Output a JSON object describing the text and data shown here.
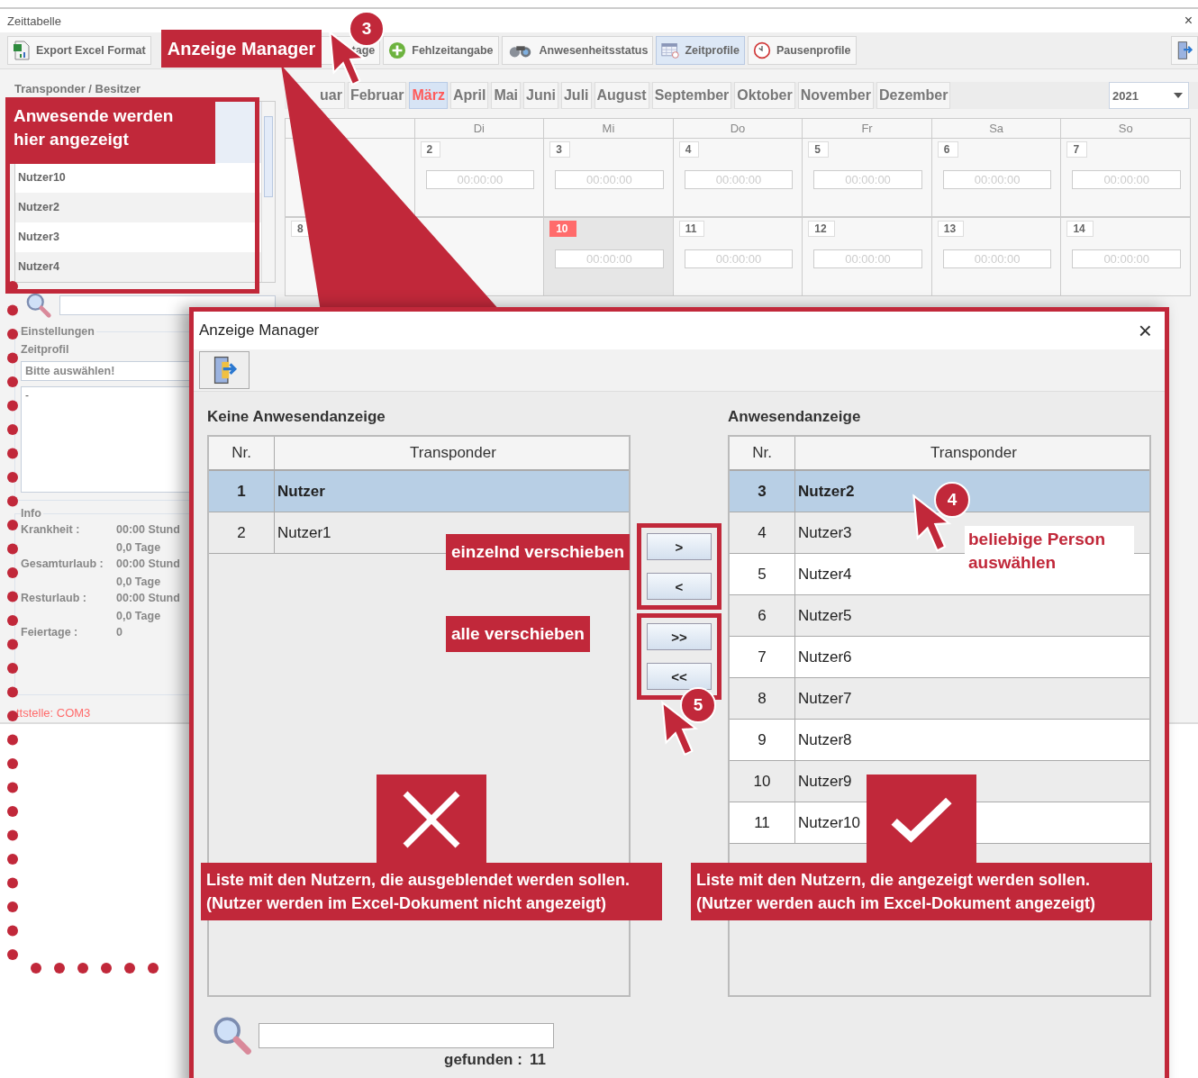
{
  "window": {
    "title": "Zeittabelle",
    "close": "×"
  },
  "toolbar": [
    {
      "label": "Export Excel Format",
      "kind": "excel",
      "selected": false
    },
    {
      "label": "tage",
      "kind": "plain",
      "selected": false
    },
    {
      "label": "Fehlzeitangabe",
      "kind": "plus",
      "selected": false
    },
    {
      "label": "Anwesenheitsstatus",
      "kind": "binoculars",
      "selected": false
    },
    {
      "label": "Zeitprofile",
      "kind": "calendar",
      "selected": true
    },
    {
      "label": "Pausenprofile",
      "kind": "clock",
      "selected": false
    }
  ],
  "left_panel": {
    "title": "Transponder / Besitzer",
    "items": [
      "Nutzer10",
      "Nutzer2",
      "Nutzer3",
      "Nutzer4"
    ],
    "settings": {
      "legend": "Einstellungen",
      "label": "Zeitprofil",
      "select": "Bitte auswählen!",
      "note": "-"
    },
    "info": {
      "legend": "Info",
      "rows": [
        {
          "label": "Krankheit :",
          "values": [
            "00:00 Stund",
            "0,0 Tage"
          ]
        },
        {
          "label": "Gesamturlaub :",
          "values": [
            "00:00 Stund",
            "0,0 Tage"
          ]
        },
        {
          "label": "Resturlaub :",
          "values": [
            "00:00 Stund",
            "0,0 Tage"
          ]
        },
        {
          "label": "Feiertage :",
          "values": [
            "0"
          ]
        }
      ]
    },
    "status": "ttstelle: COM3"
  },
  "calendar": {
    "months": [
      {
        "label": "uar",
        "selected": false
      },
      {
        "label": "Februar",
        "selected": false
      },
      {
        "label": "März",
        "selected": true
      },
      {
        "label": "April",
        "selected": false
      },
      {
        "label": "Mai",
        "selected": false
      },
      {
        "label": "Juni",
        "selected": false
      },
      {
        "label": "Juli",
        "selected": false
      },
      {
        "label": "August",
        "selected": false
      },
      {
        "label": "September",
        "selected": false
      },
      {
        "label": "Oktober",
        "selected": false
      },
      {
        "label": "November",
        "selected": false
      },
      {
        "label": "Dezember",
        "selected": false
      }
    ],
    "year": "2021",
    "weekdays": [
      "Di",
      "Mi",
      "Do",
      "Fr",
      "Sa",
      "So"
    ],
    "weeks": [
      [
        {
          "today": false
        },
        {
          "day": "2",
          "time": "00:00:00",
          "today": false
        },
        {
          "day": "3",
          "time": "00:00:00",
          "today": false
        },
        {
          "day": "4",
          "time": "00:00:00",
          "today": false
        },
        {
          "day": "5",
          "time": "00:00:00",
          "today": false
        },
        {
          "day": "6",
          "time": "00:00:00",
          "today": false
        },
        {
          "day": "7",
          "time": "00:00:00",
          "today": false
        }
      ],
      [
        {
          "day": "8",
          "today": false
        },
        {
          "today": false
        },
        {
          "day": "10",
          "time": "00:00:00",
          "today": true
        },
        {
          "day": "11",
          "time": "00:00:00",
          "today": false
        },
        {
          "day": "12",
          "time": "00:00:00",
          "today": false
        },
        {
          "day": "13",
          "time": "00:00:00",
          "today": false
        },
        {
          "day": "14",
          "time": "00:00:00",
          "today": false
        }
      ]
    ]
  },
  "annotations": {
    "button_callout": "Anzeige Manager",
    "badge": "3",
    "list_callout": "Anwesende werden hier angezeigt"
  },
  "dialog": {
    "title": "Anzeige Manager",
    "close": "×",
    "left": {
      "title": "Keine Anwesendanzeige",
      "columns": [
        "Nr.",
        "Transponder"
      ],
      "rows": [
        {
          "nr": "1",
          "name": "Nutzer",
          "selected": true
        },
        {
          "nr": "2",
          "name": "Nutzer1",
          "selected": false
        }
      ]
    },
    "buttons": [
      ">",
      "<",
      ">>",
      "<<"
    ],
    "right": {
      "title": "Anwesendanzeige",
      "columns": [
        "Nr.",
        "Transponder"
      ],
      "rows": [
        {
          "nr": "3",
          "name": "Nutzer2",
          "selected": true
        },
        {
          "nr": "4",
          "name": "Nutzer3",
          "selected": false
        },
        {
          "nr": "5",
          "name": "Nutzer4",
          "selected": false
        },
        {
          "nr": "6",
          "name": "Nutzer5",
          "selected": false
        },
        {
          "nr": "7",
          "name": "Nutzer6",
          "selected": false
        },
        {
          "nr": "8",
          "name": "Nutzer7",
          "selected": false
        },
        {
          "nr": "9",
          "name": "Nutzer8",
          "selected": false
        },
        {
          "nr": "10",
          "name": "Nutzer9",
          "selected": false
        },
        {
          "nr": "11",
          "name": "Nutzer10",
          "selected": false
        }
      ]
    },
    "found_label": "gefunden :",
    "found_count": "11",
    "callouts": {
      "single": "einzelnd verschieben",
      "all": "alle verschieben",
      "pick": "beliebige Person auswählen",
      "badge_pick": "4",
      "badge_buttons": "5",
      "hidden_caption": "Liste mit den Nutzern, die ausgeblendet werden sollen.\n(Nutzer werden im Excel-Dokument nicht angezeigt)",
      "shown_caption": "Liste mit den Nutzern, die angezeigt werden sollen.\n(Nutzer werden auch im Excel-Dokument angezeigt)"
    }
  }
}
